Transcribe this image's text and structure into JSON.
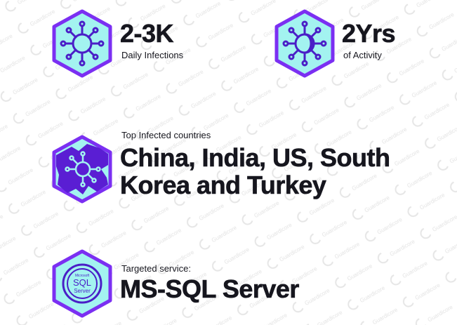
{
  "colors": {
    "hex_fill": "#a3f3f0",
    "hex_border": "#7b2ff2",
    "icon_stroke": "#4a1ec7",
    "text": "#16161e",
    "watermark": "#e6e6e6"
  },
  "watermark": {
    "text": "Guardicore"
  },
  "stats": {
    "infections": {
      "value": "2-3K",
      "label": "Daily Infections",
      "icon": "virus-icon"
    },
    "activity": {
      "value": "2Yrs",
      "label": "of Activity",
      "icon": "virus-clock-icon"
    }
  },
  "countries": {
    "heading": "Top Infected countries",
    "line1": "China, India, US, South",
    "line2": "Korea and Turkey",
    "icon": "globe-virus-icon"
  },
  "service": {
    "heading": "Targeted service:",
    "name": "MS-SQL Server",
    "icon": "sql-server-icon",
    "logo_text": {
      "brand": "Microsoft",
      "sql": "SQL",
      "server": "Server"
    }
  }
}
